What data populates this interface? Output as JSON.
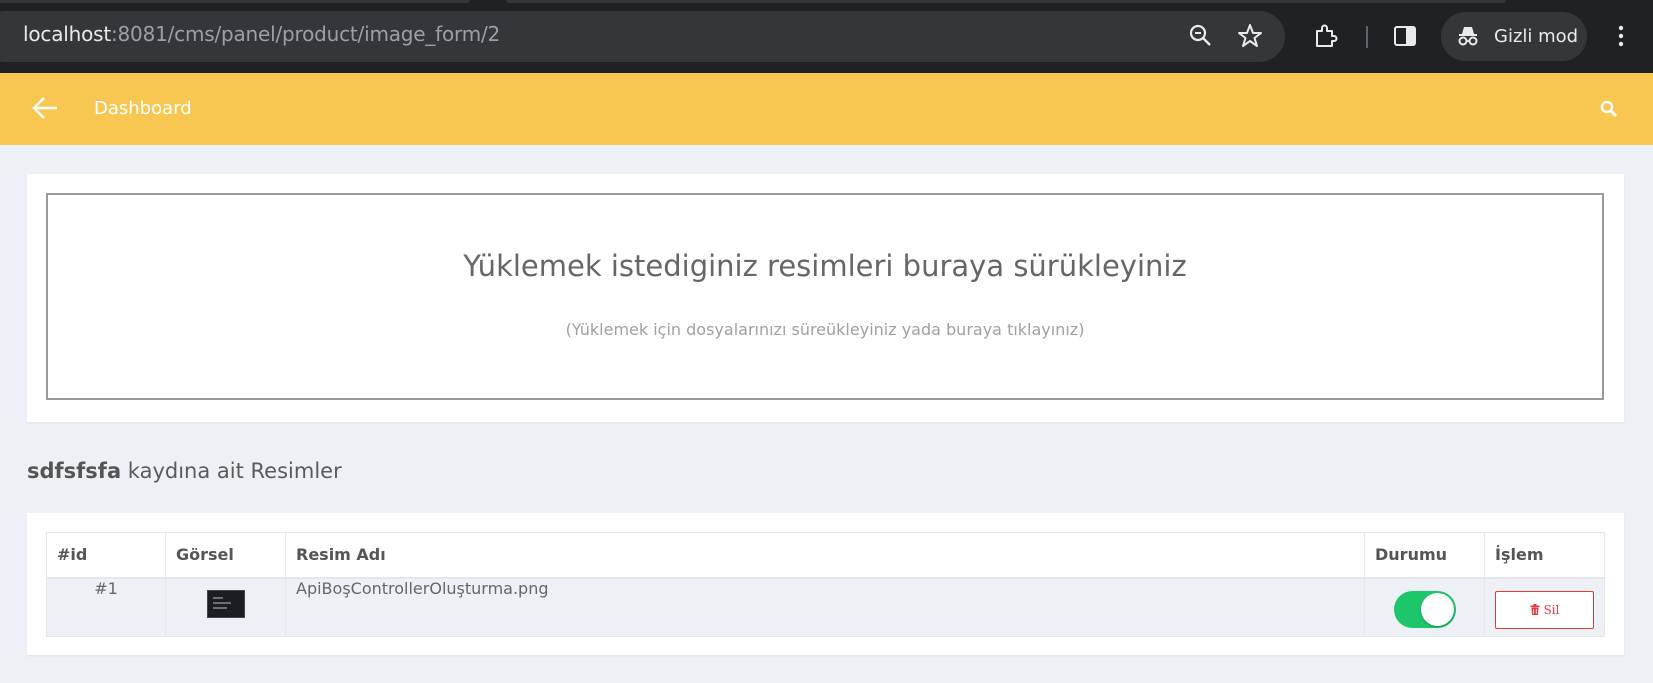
{
  "browser": {
    "url_host": "localhost",
    "url_path": ":8081/cms/panel/product/image_form/2",
    "incognito_label": "Gizli mod"
  },
  "header": {
    "title": "Dashboard",
    "background": "#f8c752"
  },
  "dropzone": {
    "title": "Yüklemek istediginiz resimleri buraya sürükleyiniz",
    "subtitle": "(Yüklemek için dosyalarınızı süreükleyiniz yada buraya tıklayınız)"
  },
  "section": {
    "record_name": "sdfsfsfa",
    "heading_suffix": " kaydına ait Resimler"
  },
  "table": {
    "columns": [
      "#id",
      "Görsel",
      "Resim Adı",
      "Durumu",
      "İşlem"
    ],
    "rows": [
      {
        "id": "#1",
        "image_name": "ApiBoşControllerOluşturma.png",
        "status_active": true,
        "action_label": "Sil",
        "action_icon": "trash-icon"
      }
    ]
  },
  "colors": {
    "toggle_on": "#1ec66b",
    "danger": "#e0393e"
  }
}
